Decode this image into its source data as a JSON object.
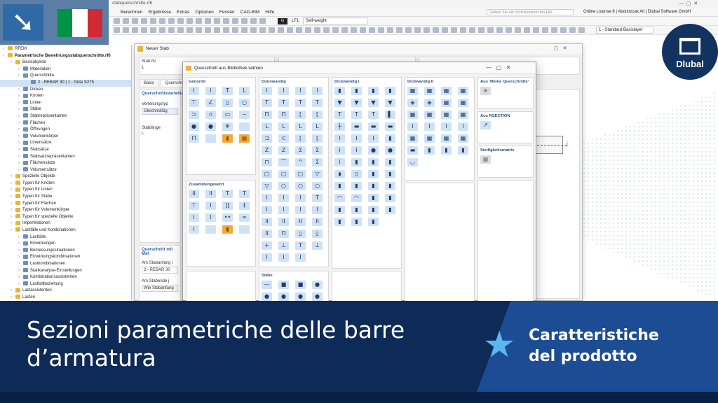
{
  "app": {
    "title": "stabquerschnitte.rf6",
    "menu": [
      "Berechnen",
      "Ergebnisse",
      "Extras",
      "Optionen",
      "Fenster",
      "CAD-BIM",
      "Hilfe"
    ],
    "search_placeholder": "Geben Sie ein Schlüsselwort ein (Alt...",
    "license": "Online License 8 | Abdulrzzak Ali | Dlubal Software GmbH",
    "loadcase_code": "G",
    "loadcase_lf": "LF1",
    "loadcase_name": "Self-weight",
    "layer": "1 - Standard-Basislayer"
  },
  "flag": {
    "colors": [
      "#009246",
      "#ffffff",
      "#ce2b37"
    ]
  },
  "navigator": {
    "items": [
      {
        "label": "RFEM",
        "level": 0
      },
      {
        "label": "Parametrische Bewehrungsstabquerschnitte.rf6",
        "level": 0,
        "bold": true
      },
      {
        "label": "Basisobjekte",
        "level": 1
      },
      {
        "label": "Materialien",
        "level": 2
      },
      {
        "label": "Querschnitte",
        "level": 2
      },
      {
        "label": "2 - REBAR 30 | 1 - Güte S275",
        "level": 3,
        "selected": true
      },
      {
        "label": "Dicken",
        "level": 2
      },
      {
        "label": "Knoten",
        "level": 2
      },
      {
        "label": "Linien",
        "level": 2
      },
      {
        "label": "Stäbe",
        "level": 2
      },
      {
        "label": "Stabrepräsentanten",
        "level": 2
      },
      {
        "label": "Flächen",
        "level": 2
      },
      {
        "label": "Öffnungen",
        "level": 2
      },
      {
        "label": "Volumenkörper",
        "level": 2
      },
      {
        "label": "Liniensätze",
        "level": 2
      },
      {
        "label": "Stabsätze",
        "level": 2
      },
      {
        "label": "Stabsatzrepräsentanten",
        "level": 2
      },
      {
        "label": "Flächensätze",
        "level": 2
      },
      {
        "label": "Volumensätze",
        "level": 2
      },
      {
        "label": "Spezielle Objekte",
        "level": 1
      },
      {
        "label": "Typen für Knoten",
        "level": 1
      },
      {
        "label": "Typen für Linien",
        "level": 1
      },
      {
        "label": "Typen für Stäbe",
        "level": 1
      },
      {
        "label": "Typen für Flächen",
        "level": 1
      },
      {
        "label": "Typen für Volumenkörper",
        "level": 1
      },
      {
        "label": "Typen für spezielle Objekte",
        "level": 1
      },
      {
        "label": "Imperfektionen",
        "level": 1
      },
      {
        "label": "Lastfälle und Kombinationen",
        "level": 1
      },
      {
        "label": "Lastfälle",
        "level": 2
      },
      {
        "label": "Einwirkungen",
        "level": 2
      },
      {
        "label": "Bemessungssituationen",
        "level": 2
      },
      {
        "label": "Einwirkungskombinationen",
        "level": 2
      },
      {
        "label": "Lastkombinationen",
        "level": 2
      },
      {
        "label": "Statikanalyse-Einstellungen",
        "level": 2
      },
      {
        "label": "Kombinationsassistenten",
        "level": 2
      },
      {
        "label": "Lastfallbeziehung",
        "level": 2
      },
      {
        "label": "Lastassistenten",
        "level": 1
      },
      {
        "label": "Lasten",
        "level": 1
      }
    ]
  },
  "stab_window": {
    "title": "Neuer Stab",
    "stab_nr_label": "Stab Nr.",
    "stab_nr": "1",
    "tabs": [
      "Basis",
      "Querschn"
    ],
    "section_title": "Querschnittsverteilung",
    "verteilungstyp_label": "Verteilungstyp",
    "verteilungstyp": "Gleichmäßig",
    "stablaenge_label": "Stablänge",
    "l_label": "L",
    "qs_mit_mat": "Querschnitt mit Mat",
    "am_stabanfang_label": "Am Stabanfang i",
    "am_stabanfang": "2 - REBAR 30",
    "am_stabende_label": "Am Stabende j",
    "am_stabende": "Wie Stabanfang",
    "node_j": "j"
  },
  "library": {
    "title": "Querschnitt aus Bibliothek wählen",
    "groups": {
      "genormt": "Genormt",
      "zusammengesetzt": "Zusammengesetzt",
      "duennwandig": "Dünnwandig",
      "staebe": "Stäbe",
      "dickwandig1": "Dickwandig I",
      "dickwandig2": "Dickwandig II",
      "meine": "Aus 'Meine Querschnitte'",
      "rsection": "Aus RSECTION",
      "steifigkeit": "Steifigkeitsmatrix"
    }
  },
  "banner": {
    "title_line1": "Sezioni parametriche delle barre",
    "title_line2": "d’armatura",
    "subtitle_line1": "Caratteristiche",
    "subtitle_line2": "del prodotto"
  },
  "logo": {
    "text": "Dlubal"
  }
}
